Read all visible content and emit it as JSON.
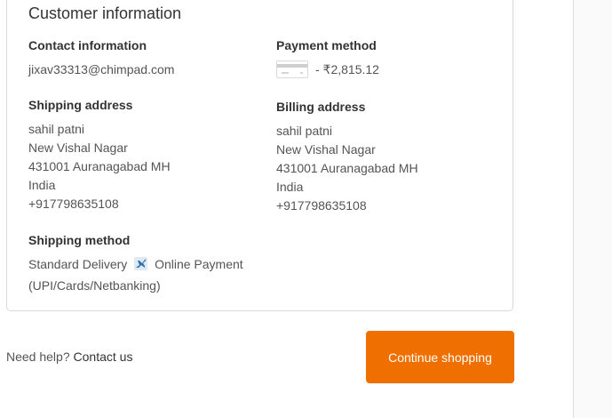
{
  "customer_info": {
    "title": "Customer information",
    "contact": {
      "heading": "Contact information",
      "email": "jixav33313@chimpad.com"
    },
    "payment": {
      "heading": "Payment method",
      "amount_text": "- ₹2,815.12",
      "icon": "credit-card-icon"
    },
    "shipping_address": {
      "heading": "Shipping address",
      "lines": [
        "sahil patni",
        "New Vishal Nagar",
        "431001 Auranagabad MH",
        "India",
        "+917798635108"
      ]
    },
    "billing_address": {
      "heading": "Billing address",
      "lines": [
        "sahil patni",
        "New Vishal Nagar",
        "431001 Auranagabad MH",
        "India",
        "+917798635108"
      ]
    },
    "shipping_method": {
      "heading": "Shipping method",
      "line1_before": "Standard Delivery",
      "line1_after": "Online Payment",
      "line2": "(UPI/Cards/Netbanking)",
      "icon": "airplane-icon"
    }
  },
  "footer": {
    "help_text": "Need help?",
    "contact_link": "Contact us",
    "continue_button": "Continue shopping"
  },
  "colors": {
    "accent": "#ef7000",
    "text": "#545454",
    "heading": "#333333",
    "border": "#d9d9d9"
  }
}
